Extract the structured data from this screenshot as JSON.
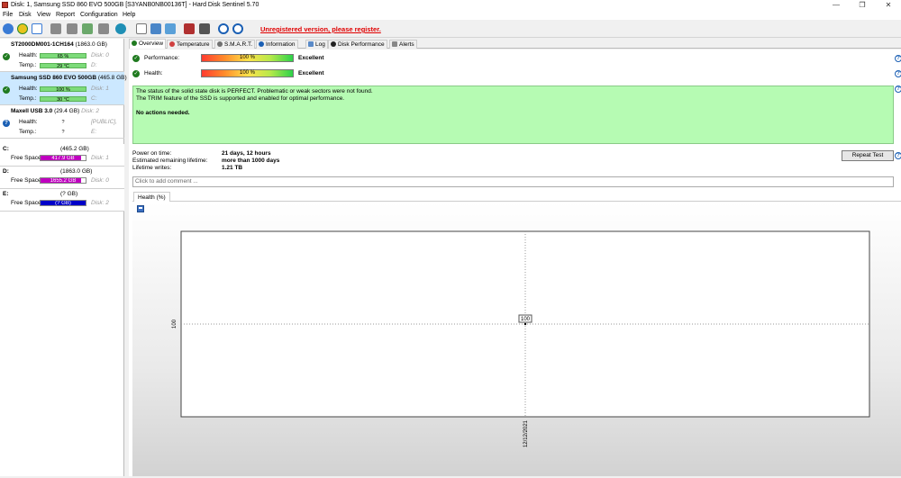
{
  "window": {
    "title": "Disk: 1, Samsung SSD 860 EVO 500GB [S3YANB0NB00136T]  -  Hard Disk Sentinel 5.70",
    "controls": {
      "minimize": "—",
      "maximize": "❐",
      "close": "✕"
    }
  },
  "menu": [
    "File",
    "Disk",
    "View",
    "Report",
    "Configuration",
    "Help"
  ],
  "toolbar": {
    "icons": [
      "refresh-icon",
      "disk-health-icon",
      "mail-icon",
      "tool-1-icon",
      "tool-2-icon",
      "tool-3-icon",
      "tool-4-icon",
      "globe-icon",
      "report-icon",
      "config-icon",
      "update-icon",
      "chart-icon",
      "settings-icon",
      "help-icon",
      "info-icon"
    ],
    "unregistered": "Unregistered version, please register."
  },
  "disks": [
    {
      "name": "ST2000DM001-1CH164",
      "size": "(1863.0 GB)",
      "status": "ok",
      "health_label": "Health:",
      "health": "65 %",
      "health_ref": "Disk: 0",
      "health_fill": 0.65,
      "temp_label": "Temp.:",
      "temp": "29 °C",
      "temp_ref": "D:"
    },
    {
      "name": "Samsung SSD 860 EVO 500GB",
      "size": "(465.8 GB)",
      "status": "ok",
      "health_label": "Health:",
      "health": "100 %",
      "health_ref": "Disk: 1",
      "health_fill": 1.0,
      "temp_label": "Temp.:",
      "temp": "30 °C",
      "temp_ref": "C:"
    },
    {
      "name": "Maxell USB 3.0",
      "size": "(29.4 GB)",
      "disk_ref": "Disk: 2",
      "status": "unknown",
      "health_label": "Health:",
      "health": "?",
      "health_ref": "[PUBLIC],",
      "health_fill": 0,
      "temp_label": "Temp.:",
      "temp": "?",
      "temp_ref": "E:"
    }
  ],
  "volumes": [
    {
      "letter": "C:",
      "size": "(465.2 GB)",
      "free_label": "Free Space",
      "free": "417.9 GB",
      "free_fraction": 0.9,
      "color": "#c000c0",
      "disk": "Disk: 1"
    },
    {
      "letter": "D:",
      "size": "(1863.0 GB)",
      "free_label": "Free Space",
      "free": "1655.2 GB",
      "free_fraction": 0.89,
      "color": "#c000c0",
      "disk": "Disk: 0"
    },
    {
      "letter": "E:",
      "size": "(? GB)",
      "free_label": "Free Space",
      "free": "(? GB)",
      "free_fraction": 1.0,
      "color": "#0000c8",
      "disk": "Disk: 2"
    }
  ],
  "tabs": [
    "Overview",
    "Temperature",
    "S.M.A.R.T.",
    "Information",
    "Log",
    "Disk Performance",
    "Alerts"
  ],
  "overview": {
    "performance": {
      "label": "Performance:",
      "bar": "100 %",
      "value": "Excellent"
    },
    "health": {
      "label": "Health:",
      "bar": "100 %",
      "value": "Excellent"
    },
    "status_lines": [
      "The status of the solid state disk is PERFECT. Problematic or weak sectors were not found.",
      "The TRIM feature of the SSD is supported and enabled for optimal performance."
    ],
    "status_action": "No actions needed.",
    "info": [
      {
        "label": "Power on time:",
        "value": "21 days, 12 hours"
      },
      {
        "label": "Estimated remaining lifetime:",
        "value": "more than 1000 days"
      },
      {
        "label": "Lifetime writes:",
        "value": "1.21 TB"
      }
    ],
    "repeat_button": "Repeat Test",
    "comment_placeholder": "Click to add comment ...",
    "history_tab": "Health (%)"
  },
  "chart_data": {
    "type": "line",
    "x": [
      "12/12/2021"
    ],
    "series": [
      {
        "values": [
          100
        ]
      }
    ],
    "ylabel": "",
    "xlabel": "",
    "y_tick_labels": [
      "100"
    ],
    "x_tick_labels": [
      "12/12/2021"
    ],
    "data_labels": [
      "100"
    ],
    "grid": true
  }
}
